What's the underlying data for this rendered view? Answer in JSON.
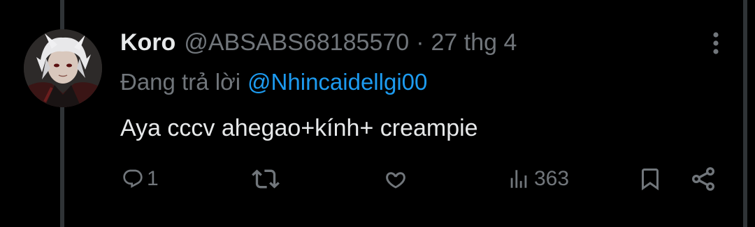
{
  "tweet": {
    "display_name": "Koro",
    "handle": "@ABSABS68185570",
    "separator": "·",
    "date": "27 thg 4",
    "reply_prefix": "Đang trả lời",
    "reply_to": "@Nhincaidellgi00",
    "text": "Aya cccv ahegao+kính+ creampie",
    "avatar_icon": "anime-avatar-white-hair"
  },
  "actions": {
    "reply_icon": "reply-icon",
    "reply_count": "1",
    "retweet_icon": "retweet-icon",
    "like_icon": "heart-icon",
    "views_icon": "views-chart-icon",
    "views_count": "363",
    "bookmark_icon": "bookmark-icon",
    "share_icon": "share-icon",
    "more_icon": "more-vertical-icon"
  },
  "colors": {
    "background": "#000000",
    "primary_text": "#e7e9ea",
    "secondary_text": "#71767b",
    "accent_link": "#1d9bf0",
    "border": "#2f3336"
  }
}
